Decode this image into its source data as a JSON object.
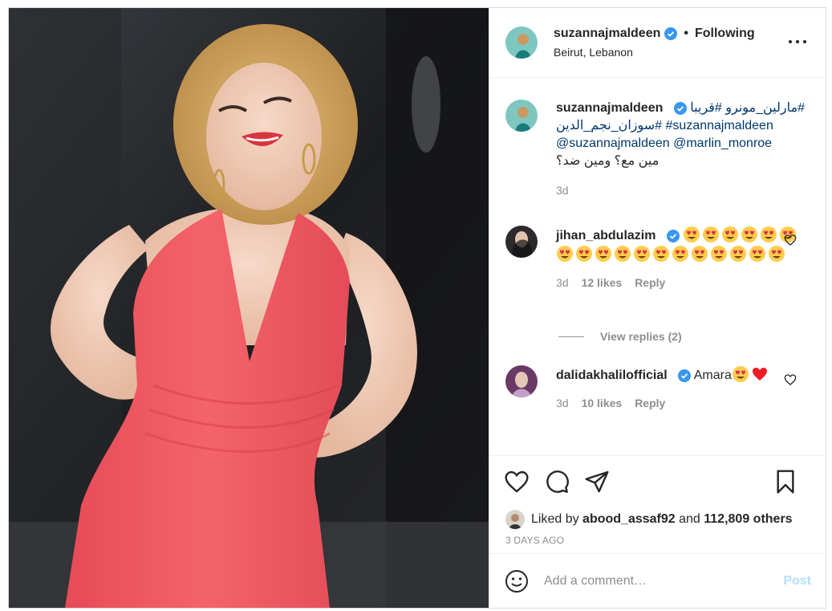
{
  "post": {
    "author": "suzannajmaldeen",
    "follow_status": "Following",
    "dot": "•",
    "location": "Beirut, Lebanon"
  },
  "caption": {
    "username": "suzannajmaldeen",
    "line1": "مارلين_مونرو #قريبا#",
    "line2": "سوزان_نجم_الدين# #suzannajmaldeen",
    "line3": "@suzannajmaldeen @marlin_monroe",
    "line4": "مين مع؟ ومين ضد؟",
    "age": "3d"
  },
  "comments": [
    {
      "username": "jihan_abdulazim",
      "text": "",
      "emoji_count": 18,
      "age": "3d",
      "likes": "12 likes",
      "reply": "Reply"
    },
    {
      "username": "dalidakhalilofficial",
      "text": "Amara",
      "age": "3d",
      "likes": "10 likes",
      "reply": "Reply"
    }
  ],
  "view_replies": "View replies (2)",
  "likes": {
    "prefix": "Liked by",
    "user": "abood_assaf92",
    "joiner": "and",
    "others": "112,809 others"
  },
  "time_ago": "3 DAYS AGO",
  "add_comment": {
    "placeholder": "Add a comment…",
    "post_label": "Post"
  },
  "colors": {
    "verified": "#3897f0",
    "post_disabled": "#b2dffc",
    "dress": "#f0585f",
    "heart_red": "#ed1c24"
  },
  "icons": [
    "verified-icon",
    "more-icon",
    "heart-icon",
    "comment-icon",
    "share-icon",
    "save-icon",
    "smile-icon",
    "heart-eyes-emoji",
    "red-heart-emoji"
  ]
}
